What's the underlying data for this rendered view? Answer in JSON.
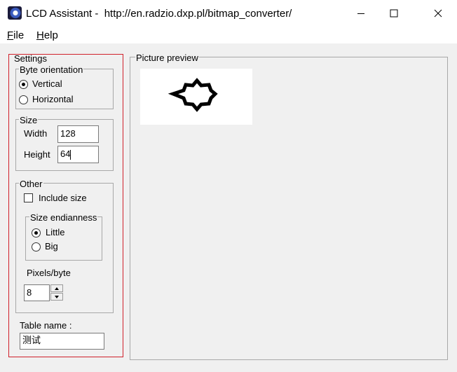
{
  "window": {
    "title": "LCD Assistant -  http://en.radzio.dxp.pl/bitmap_converter/",
    "icon": "app-icon"
  },
  "menu": {
    "file_prefix": "F",
    "file_rest": "ile",
    "help_prefix": "H",
    "help_rest": "elp"
  },
  "settings": {
    "label": "Settings",
    "byte_orientation": {
      "label": "Byte orientation",
      "options": [
        "Vertical",
        "Horizontal"
      ],
      "selected": "Vertical"
    },
    "size": {
      "label": "Size",
      "width_label": "Width",
      "width_value": "128",
      "height_label": "Height",
      "height_value": "64"
    },
    "other": {
      "label": "Other",
      "include_size_label": "Include size",
      "include_size_checked": false,
      "size_endianness": {
        "label": "Size endianness",
        "options": [
          "Little",
          "Big"
        ],
        "selected": "Little"
      },
      "pixels_per_byte_label": "Pixels/byte",
      "pixels_per_byte_value": "8"
    },
    "table_name_label": "Table name :",
    "table_name_value": "测试"
  },
  "preview": {
    "label": "Picture preview",
    "image": "six-pointed-star-outline"
  },
  "colors": {
    "highlight_outline": "#d0202a",
    "window_bg": "#f0f0f0"
  }
}
